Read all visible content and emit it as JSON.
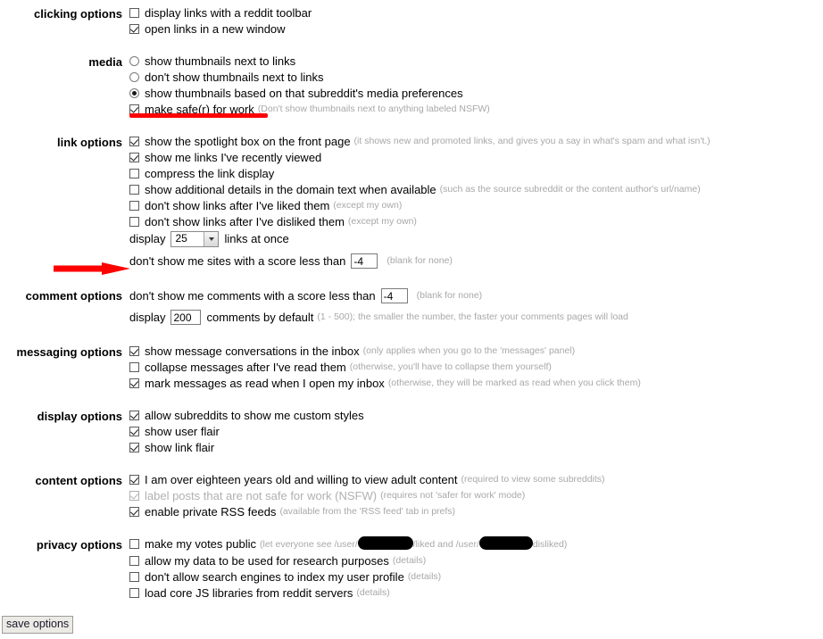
{
  "page": {
    "title": "reddit preferences",
    "accent_red": "#fe0000",
    "note_color": "#a8a8a8"
  },
  "groups": [
    {
      "id": "clicking-options",
      "label": "clicking options",
      "rows": [
        {
          "kind": "checkbox",
          "checked": false,
          "text": "display links with a reddit toolbar",
          "note": ""
        },
        {
          "kind": "checkbox",
          "checked": true,
          "text": "open links in a new window",
          "note": ""
        }
      ]
    },
    {
      "id": "media",
      "label": "media",
      "rows": [
        {
          "kind": "radio",
          "checked": false,
          "text": "show thumbnails next to links",
          "note": ""
        },
        {
          "kind": "radio",
          "checked": false,
          "text": "don't show thumbnails next to links",
          "note": ""
        },
        {
          "kind": "radio",
          "checked": true,
          "text": "show thumbnails based on that subreddit's media preferences",
          "note": ""
        },
        {
          "kind": "checkbox",
          "checked": true,
          "text": "make safe(r) for work",
          "note": "(Don't show thumbnails next to anything labeled NSFW)"
        }
      ]
    },
    {
      "id": "link-options",
      "label": "link options",
      "rows": [
        {
          "kind": "checkbox",
          "checked": true,
          "text": "show the spotlight box on the front page",
          "note": "(it shows new and promoted links, and gives you a say in what's spam and what isn't.)"
        },
        {
          "kind": "checkbox",
          "checked": true,
          "text": "show me links I've recently viewed",
          "note": ""
        },
        {
          "kind": "checkbox",
          "checked": false,
          "text": "compress the link display",
          "note": ""
        },
        {
          "kind": "checkbox",
          "checked": false,
          "text": "show additional details in the domain text when available",
          "note": "(such as the source subreddit or the content author's url/name)"
        },
        {
          "kind": "checkbox",
          "checked": false,
          "text": "don't show links after I've liked them",
          "note": "(except my own)"
        },
        {
          "kind": "checkbox",
          "checked": false,
          "text": "don't show links after I've disliked them",
          "note": "(except my own)"
        }
      ],
      "select_row": {
        "lead": "display",
        "value": "25",
        "trail": "links at once"
      },
      "score_row": {
        "lead": "don't show me sites with a score less than",
        "value": "-4",
        "note": "(blank for none)"
      }
    },
    {
      "id": "comment-options",
      "label": "comment options",
      "score_row": {
        "lead": "don't show me comments with a score less than",
        "value": "-4",
        "note": "(blank for none)"
      },
      "display_row": {
        "lead": "display",
        "value": "200",
        "trail": "comments by default",
        "note": "(1 - 500); the smaller the number, the faster your comments pages will load"
      }
    },
    {
      "id": "messaging-options",
      "label": "messaging options",
      "rows": [
        {
          "kind": "checkbox",
          "checked": true,
          "text": "show message conversations in the inbox",
          "note": "(only applies when you go to the 'messages' panel)"
        },
        {
          "kind": "checkbox",
          "checked": false,
          "text": "collapse messages after I've read them",
          "note": "(otherwise, you'll have to collapse them yourself)"
        },
        {
          "kind": "checkbox",
          "checked": true,
          "text": "mark messages as read when I open my inbox",
          "note": "(otherwise, they will be marked as read when you click them)"
        }
      ]
    },
    {
      "id": "display-options",
      "label": "display options",
      "rows": [
        {
          "kind": "checkbox",
          "checked": true,
          "text": "allow subreddits to show me custom styles",
          "note": ""
        },
        {
          "kind": "checkbox",
          "checked": true,
          "text": "show user flair",
          "note": ""
        },
        {
          "kind": "checkbox",
          "checked": true,
          "text": "show link flair",
          "note": ""
        }
      ]
    },
    {
      "id": "content-options",
      "label": "content options",
      "rows": [
        {
          "kind": "checkbox",
          "checked": true,
          "disabled": false,
          "text": "I am over eighteen years old and willing to view adult content",
          "note": "(required to view some subreddits)"
        },
        {
          "kind": "checkbox",
          "checked": true,
          "disabled": true,
          "text": "label posts that are not safe for work (NSFW)",
          "note": "(requires not 'safer for work' mode)"
        },
        {
          "kind": "checkbox",
          "checked": true,
          "disabled": false,
          "text": "enable private RSS feeds",
          "note": "(available from the 'RSS feed' tab in prefs)"
        }
      ]
    },
    {
      "id": "privacy-options",
      "label": "privacy options",
      "rows": [
        {
          "kind": "checkbox",
          "checked": false,
          "text": "make my votes public",
          "note": "REDACTED_VOTES"
        },
        {
          "kind": "checkbox",
          "checked": false,
          "text": "allow my data to be used for research purposes",
          "note": "(details)"
        },
        {
          "kind": "checkbox",
          "checked": false,
          "text": "don't allow search engines to index my user profile",
          "note": "(details)"
        },
        {
          "kind": "checkbox",
          "checked": false,
          "text": "load core JS libraries from reddit servers",
          "note": "(details)"
        }
      ],
      "votes_note": {
        "prefix": "(let everyone see /user/",
        "middle": "/liked and /user/",
        "suffix": "disliked)"
      }
    }
  ],
  "save": {
    "label": "save options"
  },
  "annotations": {
    "underline": {
      "color": "#fe0000",
      "targets": "make safe(r) for work"
    },
    "arrow": {
      "color": "#fe0000",
      "targets": "don't show me sites with a score less than"
    }
  }
}
